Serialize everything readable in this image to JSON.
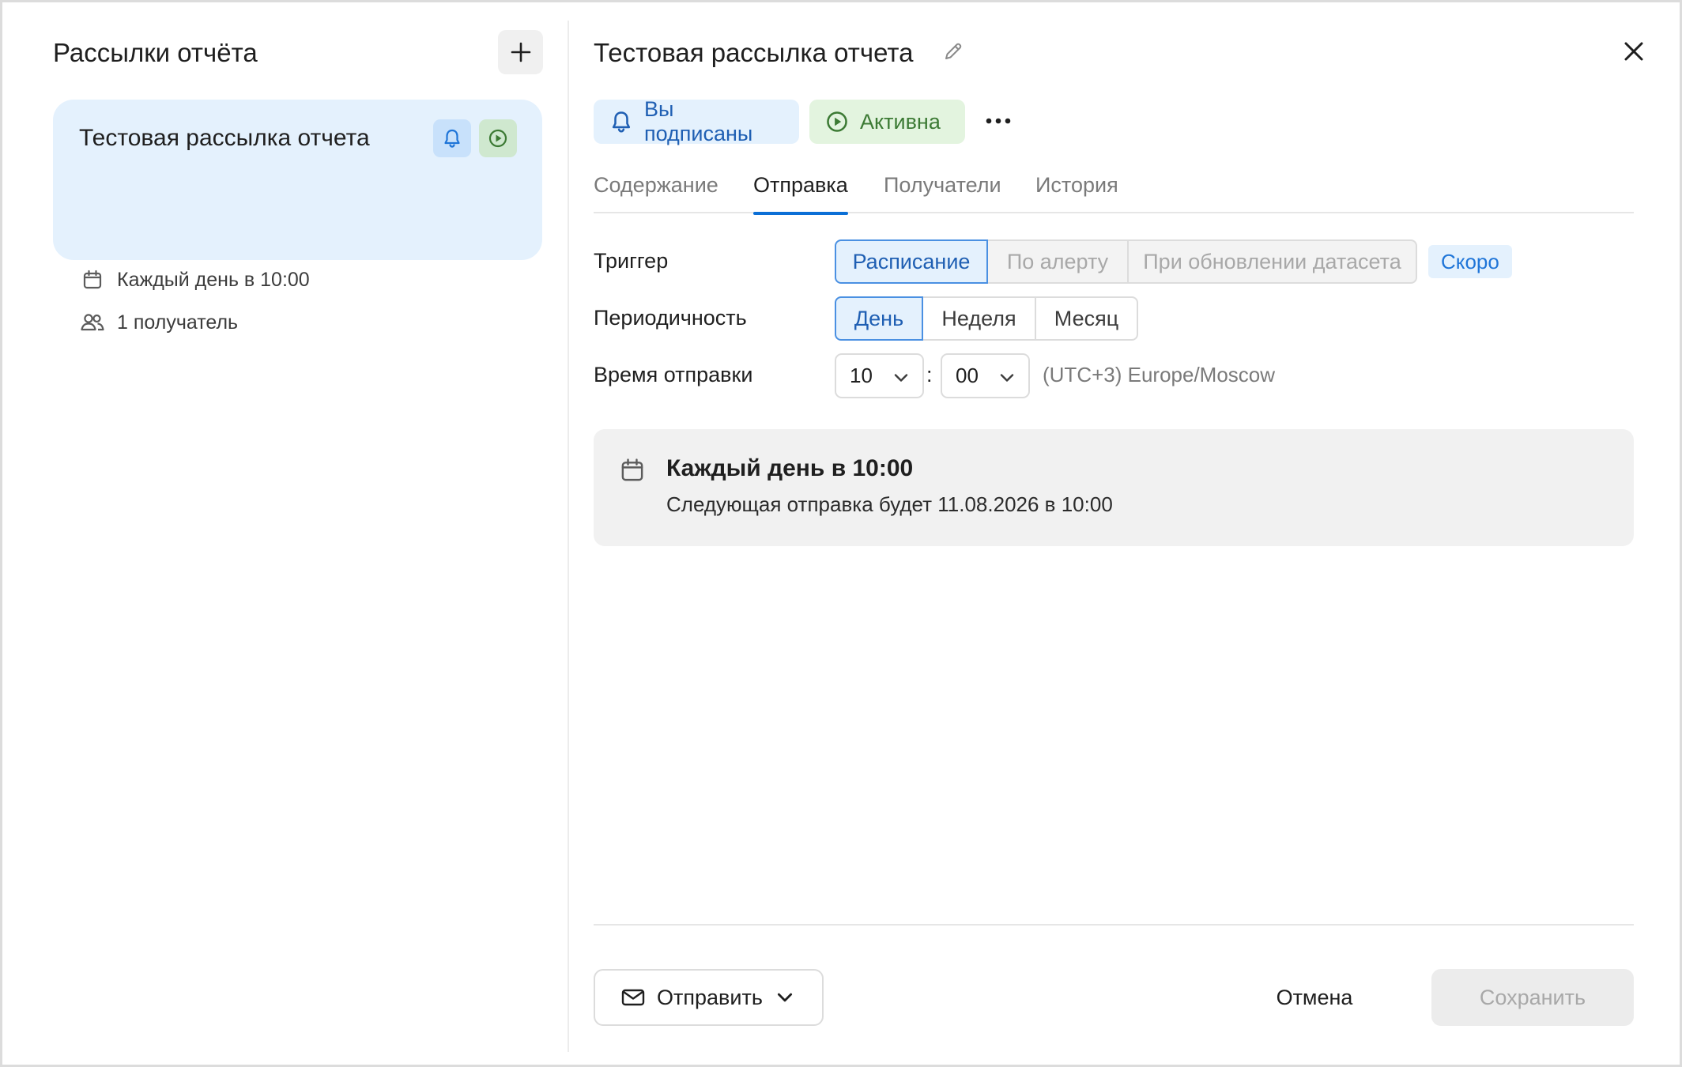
{
  "sidebar": {
    "title": "Рассылки отчёта",
    "add_icon": "plus-icon",
    "items": [
      {
        "title": "Тестовая рассылка отчета",
        "schedule": "Каждый день в 10:00",
        "recipients": "1 получатель",
        "badges": [
          "bell-icon",
          "play-circle-icon"
        ]
      }
    ]
  },
  "header": {
    "title": "Тестовая рассылка отчета",
    "edit_icon": "pencil-icon",
    "close_icon": "close-icon"
  },
  "status": {
    "subscribed_label": "Вы подписаны",
    "active_label": "Активна",
    "more_icon": "more-horizontal-icon"
  },
  "tabs": [
    {
      "label": "Содержание",
      "active": false
    },
    {
      "label": "Отправка",
      "active": true
    },
    {
      "label": "Получатели",
      "active": false
    },
    {
      "label": "История",
      "active": false
    }
  ],
  "form": {
    "trigger": {
      "label": "Триггер",
      "options": [
        "Расписание",
        "По алерту",
        "При обновлении датасета"
      ],
      "selected": "Расписание",
      "soon_badge": "Скоро"
    },
    "periodicity": {
      "label": "Периодичность",
      "options": [
        "День",
        "Неделя",
        "Месяц"
      ],
      "selected": "День"
    },
    "send_time": {
      "label": "Время отправки",
      "hour": "10",
      "separator": ":",
      "minute": "00",
      "timezone": "(UTC+3) Europe/Moscow"
    }
  },
  "summary": {
    "icon": "calendar-icon",
    "title": "Каждый день в 10:00",
    "next": "Следующая отправка будет 11.08.2026 в 10:00"
  },
  "footer": {
    "send_label": "Отправить",
    "cancel_label": "Отмена",
    "save_label": "Сохранить"
  },
  "colors": {
    "accent": "#0b6fd6",
    "selected_bg": "#e4f1fd",
    "active_green": "#3c7a34"
  }
}
